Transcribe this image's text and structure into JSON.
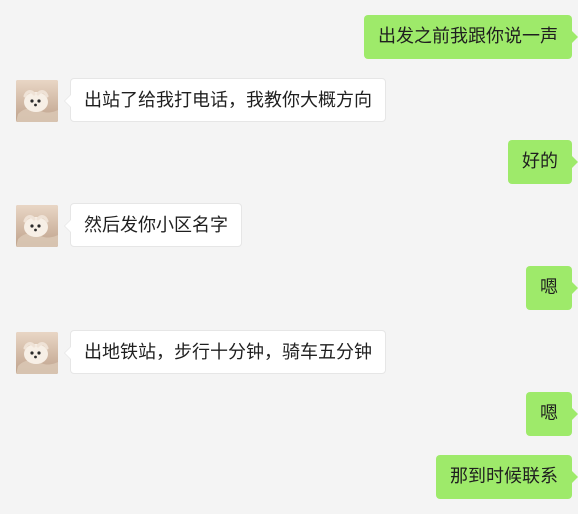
{
  "chat": {
    "messages": [
      {
        "side": "right",
        "text": "出发之前我跟你说一声"
      },
      {
        "side": "left",
        "text": "出站了给我打电话，我教你大概方向",
        "avatar": "avatar-icon"
      },
      {
        "side": "right",
        "text": "好的"
      },
      {
        "side": "left",
        "text": "然后发你小区名字",
        "avatar": "avatar-icon"
      },
      {
        "side": "right",
        "text": "嗯"
      },
      {
        "side": "left",
        "text": "出地铁站，步行十分钟，骑车五分钟",
        "avatar": "avatar-icon"
      },
      {
        "side": "right",
        "text": "嗯"
      },
      {
        "side": "right",
        "text": "那到时候联系"
      }
    ]
  },
  "colors": {
    "background": "#f4f4f4",
    "right_bubble": "#9eea6a",
    "left_bubble": "#ffffff"
  }
}
